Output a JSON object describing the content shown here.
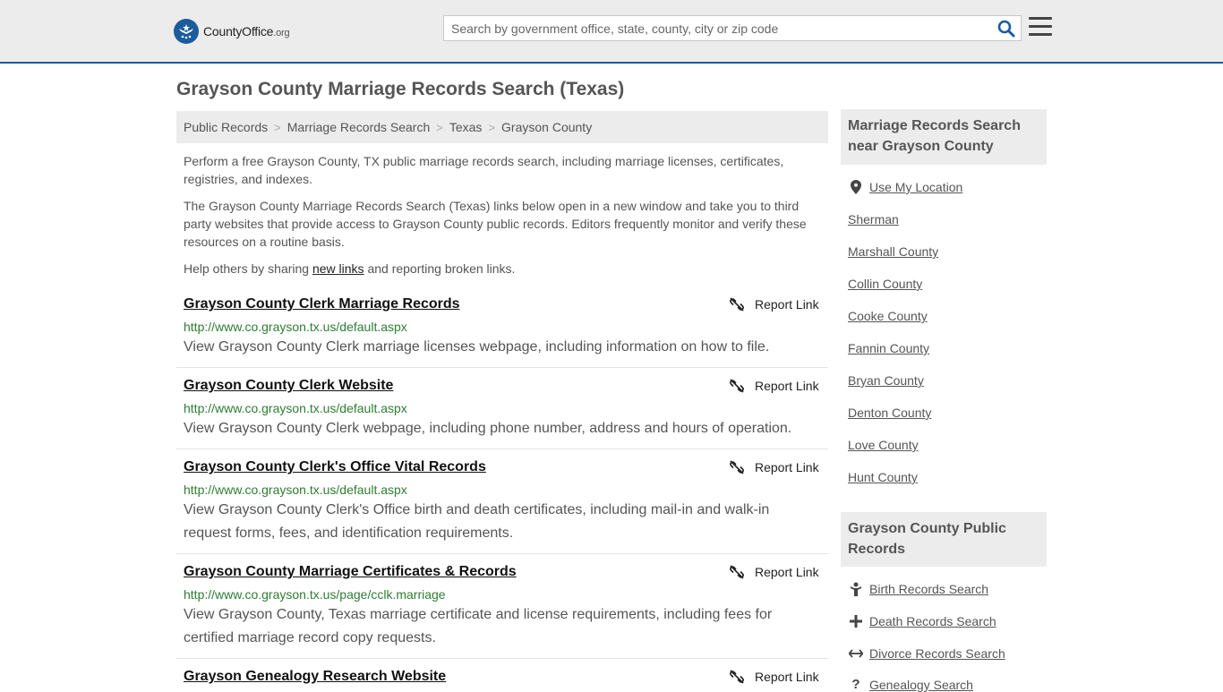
{
  "header": {
    "logo_main": "CountyOffice",
    "logo_tld": ".org",
    "search_placeholder": "Search by government office, state, county, city or zip code"
  },
  "page_title": "Grayson County Marriage Records Search (Texas)",
  "breadcrumb": [
    "Public Records",
    "Marriage Records Search",
    "Texas",
    "Grayson County"
  ],
  "intro": {
    "p1": "Perform a free Grayson County, TX public marriage records search, including marriage licenses, certificates, registries, and indexes.",
    "p2": "The Grayson County Marriage Records Search (Texas) links below open in a new window and take you to third party websites that provide access to Grayson County public records. Editors frequently monitor and verify these resources on a routine basis.",
    "p3_before": "Help others by sharing ",
    "p3_link": "new links",
    "p3_after": " and reporting broken links."
  },
  "report_label": "Report Link",
  "results": [
    {
      "title": "Grayson County Clerk Marriage Records",
      "url": "http://www.co.grayson.tx.us/default.aspx",
      "desc": "View Grayson County Clerk marriage licenses webpage, including information on how to file."
    },
    {
      "title": "Grayson County Clerk Website",
      "url": "http://www.co.grayson.tx.us/default.aspx",
      "desc": "View Grayson County Clerk webpage, including phone number, address and hours of operation."
    },
    {
      "title": "Grayson County Clerk's Office Vital Records",
      "url": "http://www.co.grayson.tx.us/default.aspx",
      "desc": "View Grayson County Clerk's Office birth and death certificates, including mail-in and walk-in request forms, fees, and identification requirements."
    },
    {
      "title": "Grayson County Marriage Certificates & Records",
      "url": "http://www.co.grayson.tx.us/page/cclk.marriage",
      "desc": "View Grayson County, Texas marriage certificate and license requirements, including fees for certified marriage record copy requests."
    },
    {
      "title": "Grayson Genealogy Research Website"
    }
  ],
  "sidebar": {
    "nearby_title": "Marriage Records Search near Grayson County",
    "use_location": "Use My Location",
    "nearby": [
      "Sherman",
      "Marshall County",
      "Collin County",
      "Cooke County",
      "Fannin County",
      "Bryan County",
      "Denton County",
      "Love County",
      "Hunt County"
    ],
    "public_title": "Grayson County Public Records",
    "public_links": [
      {
        "label": "Birth Records Search",
        "icon": "baby-icon"
      },
      {
        "label": "Death Records Search",
        "icon": "cross-icon"
      },
      {
        "label": "Divorce Records Search",
        "icon": "split-arrows-icon"
      },
      {
        "label": "Genealogy Search",
        "icon": "question-icon"
      }
    ]
  }
}
